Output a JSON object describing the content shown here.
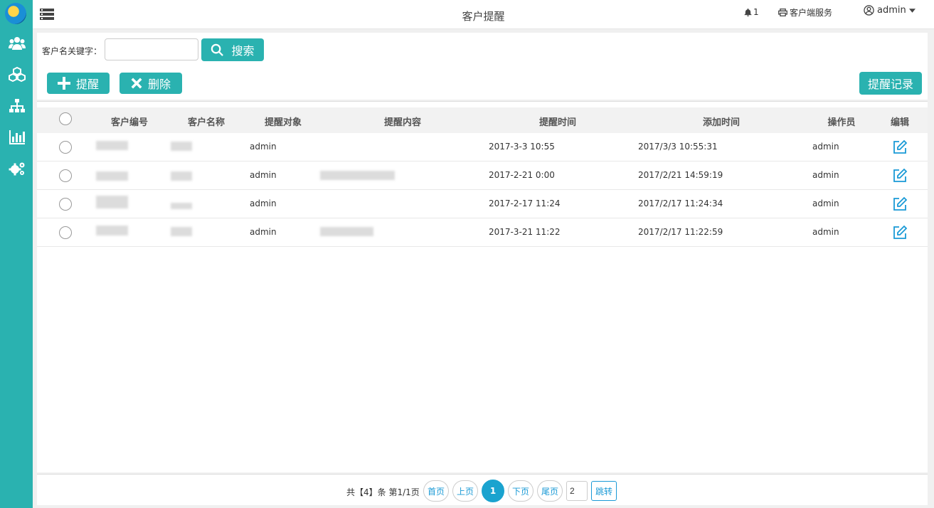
{
  "header": {
    "title": "客户提醒",
    "notification_count": "1",
    "client_service_label": "客户端服务",
    "user_name": "admin"
  },
  "search": {
    "label": "客户名关键字：",
    "value": "",
    "button_label": "搜索"
  },
  "toolbar": {
    "remind_label": "提醒",
    "delete_label": "删除",
    "log_label": "提醒记录"
  },
  "table": {
    "headers": [
      "客户编号",
      "客户名称",
      "提醒对象",
      "提醒内容",
      "提醒时间",
      "添加时间",
      "操作员",
      "编辑"
    ],
    "rows": [
      {
        "customer_no": "",
        "customer_name": "",
        "target": "admin",
        "content": "",
        "remind_time": "2017-3-3 10:55",
        "add_time": "2017/3/3 10:55:31",
        "operator": "admin"
      },
      {
        "customer_no": "",
        "customer_name": "",
        "target": "admin",
        "content": "",
        "remind_time": "2017-2-21 0:00",
        "add_time": "2017/2/21 14:59:19",
        "operator": "admin"
      },
      {
        "customer_no": "",
        "customer_name": "",
        "target": "admin",
        "content": "",
        "remind_time": "2017-2-17 11:24",
        "add_time": "2017/2/17 11:24:34",
        "operator": "admin"
      },
      {
        "customer_no": "",
        "customer_name": "",
        "target": "admin",
        "content": "",
        "remind_time": "2017-3-21 11:22",
        "add_time": "2017/2/17 11:22:59",
        "operator": "admin"
      }
    ]
  },
  "pagination": {
    "info": "共【4】条 第1/1页",
    "first_label": "首页",
    "prev_label": "上页",
    "current_page": "1",
    "next_label": "下页",
    "last_label": "尾页",
    "jump_value": "2",
    "jump_label": "跳转"
  },
  "colors": {
    "accent": "#2ab2b0",
    "link": "#1a9ad6"
  },
  "icons": {
    "sidebar": [
      "users-icon",
      "cubes-icon",
      "sitemap-icon",
      "bar-chart-icon",
      "gears-icon"
    ]
  }
}
